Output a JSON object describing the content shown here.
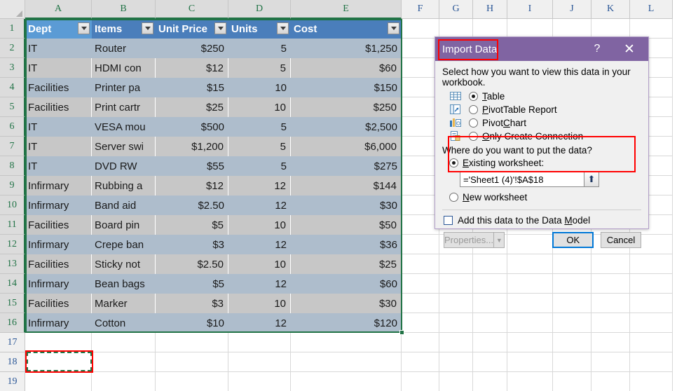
{
  "spreadsheet": {
    "column_headers": [
      "A",
      "B",
      "C",
      "D",
      "E",
      "F",
      "G",
      "H",
      "I",
      "J",
      "K",
      "L"
    ],
    "selected_columns": [
      "A",
      "B",
      "C",
      "D",
      "E"
    ],
    "row_headers": [
      "1",
      "2",
      "3",
      "4",
      "5",
      "6",
      "7",
      "8",
      "9",
      "10",
      "11",
      "12",
      "13",
      "14",
      "15",
      "16",
      "17",
      "18",
      "19"
    ],
    "selected_rows": [
      "1",
      "2",
      "3",
      "4",
      "5",
      "6",
      "7",
      "8",
      "9",
      "10",
      "11",
      "12",
      "13",
      "14",
      "15",
      "16"
    ],
    "table": {
      "headers": [
        "Dept",
        "Items",
        "Unit Price",
        "Units",
        "Cost"
      ],
      "active_header": "Dept",
      "filter_icon": "filter-dropdown-icon",
      "rows": [
        [
          "IT",
          "Router",
          "$250",
          "5",
          "$1,250"
        ],
        [
          "IT",
          "HDMI con",
          "$12",
          "5",
          "$60"
        ],
        [
          "Facilities",
          "Printer pa",
          "$15",
          "10",
          "$150"
        ],
        [
          "Facilities",
          "Print cartr",
          "$25",
          "10",
          "$250"
        ],
        [
          "IT",
          "VESA mou",
          "$500",
          "5",
          "$2,500"
        ],
        [
          "IT",
          "Server swi",
          "$1,200",
          "5",
          "$6,000"
        ],
        [
          "IT",
          "DVD RW",
          "$55",
          "5",
          "$275"
        ],
        [
          "Infirmary",
          "Rubbing a",
          "$12",
          "12",
          "$144"
        ],
        [
          "Infirmary",
          "Band aid",
          "$2.50",
          "12",
          "$30"
        ],
        [
          "Facilities",
          "Board pin",
          "$5",
          "10",
          "$50"
        ],
        [
          "Infirmary",
          "Crepe ban",
          "$3",
          "12",
          "$36"
        ],
        [
          "Facilities",
          "Sticky not",
          "$2.50",
          "10",
          "$25"
        ],
        [
          "Infirmary",
          "Bean bags",
          "$5",
          "12",
          "$60"
        ],
        [
          "Facilities",
          "Marker",
          "$3",
          "10",
          "$30"
        ],
        [
          "Infirmary",
          "Cotton",
          "$10",
          "12",
          "$120"
        ]
      ]
    },
    "copy_marquee_cell": "A18"
  },
  "dialog": {
    "title": "Import Data",
    "help_icon": "?",
    "close_icon": "✕",
    "prompt_view": "Select how you want to view this data in your workbook.",
    "view_options": [
      {
        "label": "Table",
        "selected": true,
        "icon": "table-icon"
      },
      {
        "label": "PivotTable Report",
        "selected": false,
        "icon": "pivottable-icon"
      },
      {
        "label": "PivotChart",
        "selected": false,
        "icon": "pivotchart-icon"
      },
      {
        "label": "Only Create Connection",
        "selected": false,
        "icon": "connection-icon"
      }
    ],
    "prompt_place": "Where do you want to put the data?",
    "place_options": [
      {
        "label": "Existing worksheet:",
        "selected": true
      },
      {
        "label": "New worksheet",
        "selected": false
      }
    ],
    "reference_value": "='Sheet1 (4)'!$A$18",
    "reference_picker_icon": "⬆",
    "data_model_label": "Add this data to the Data Model",
    "data_model_checked": false,
    "buttons": {
      "properties": "Properties...",
      "properties_enabled": false,
      "properties_arrow_icon": "▼",
      "ok": "OK",
      "cancel": "Cancel"
    },
    "colors": {
      "titlebar": "#8064a2",
      "highlight_box": "#ff0000",
      "default_button_border": "#0078d7"
    }
  }
}
